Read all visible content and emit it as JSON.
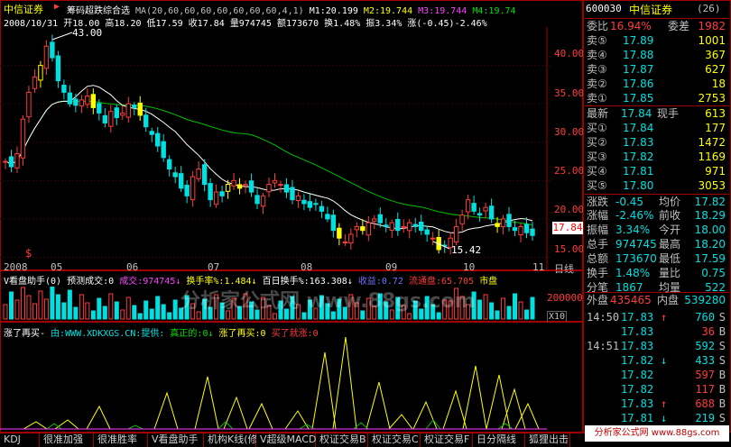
{
  "header": {
    "app_name": "中信证券",
    "indicator_title": "筹码超跌综合选",
    "ma_label": "MA(20,60,60,60,60,60,60,60,4,1)",
    "m1": "M1:20.199",
    "m2": "M2:19.744",
    "m3": "M3:19.744",
    "m4": "M4:19.74"
  },
  "ohlc": {
    "date": "2008/10/31",
    "open": "开18.00",
    "high": "高18.20",
    "low": "低17.59",
    "close": "收17.84",
    "volume": "量974745",
    "amount": "额173670",
    "turnover": "换1.48%",
    "amplitude": "振3.34%",
    "change": "涨(-0.45)-2.46%"
  },
  "main_chart": {
    "price_axis": [
      "40.00",
      "35.00",
      "30.00",
      "25.00",
      "20.00",
      "15.00"
    ],
    "high_marker": "43.00",
    "low_marker": "15.42",
    "current_price_tag": "17.84",
    "x_labels": [
      "2008",
      "05",
      "06",
      "07",
      "08",
      "09",
      "10",
      "11"
    ],
    "period_label": "日线"
  },
  "volume_panel": {
    "title": "V看盘助手(0)",
    "predict": "预测成交:0",
    "vol": "成交:974745↓",
    "turnover": "换手率%:1.484↓",
    "hundred": "百日换手%:163.308↓",
    "profit": "收益:0.72",
    "float_cap": "流通盘:65.705",
    "market": "市盘",
    "axis_label": "200000",
    "unit": "X10"
  },
  "lower_panel": {
    "title": "涨了再买-",
    "source": "由:WWW.XDKXGS.CN:提供:",
    "real": "真正的:0↓",
    "rise": "涨了再买:0",
    "buy": "买了就涨:0"
  },
  "watermark": "分析家公式网 www.88gs.com",
  "quote": {
    "code": "600030",
    "name": "中信证券",
    "count": "(26)",
    "weibi_label": "委比",
    "weibi_value": "16.94%",
    "weicha_label": "委差",
    "weicha_value": "1982",
    "sells": [
      {
        "label": "卖⑤",
        "price": "17.89",
        "vol": "1001"
      },
      {
        "label": "卖④",
        "price": "17.88",
        "vol": "367"
      },
      {
        "label": "卖③",
        "price": "17.87",
        "vol": "627"
      },
      {
        "label": "卖②",
        "price": "17.86",
        "vol": "18"
      },
      {
        "label": "卖①",
        "price": "17.85",
        "vol": "2753"
      }
    ],
    "latest_label": "最新",
    "latest_value": "17.84",
    "now_vol_label": "现手",
    "now_vol_value": "613",
    "buys": [
      {
        "label": "买①",
        "price": "17.84",
        "vol": "177"
      },
      {
        "label": "买②",
        "price": "17.83",
        "vol": "1472"
      },
      {
        "label": "买③",
        "price": "17.82",
        "vol": "1169"
      },
      {
        "label": "买④",
        "price": "17.81",
        "vol": "971"
      },
      {
        "label": "买⑤",
        "price": "17.80",
        "vol": "3053"
      }
    ],
    "stats": [
      {
        "l1": "涨跌",
        "v1": "-0.45",
        "l2": "均价",
        "v2": "17.82"
      },
      {
        "l1": "涨幅",
        "v1": "-2.46%",
        "l2": "前收",
        "v2": "18.29"
      },
      {
        "l1": "振幅",
        "v1": "3.34%",
        "l2": "今开",
        "v2": "18.00"
      },
      {
        "l1": "总手",
        "v1": "974745",
        "l2": "最高",
        "v2": "18.20"
      },
      {
        "l1": "总额",
        "v1": "173670",
        "l2": "最低",
        "v2": "17.59"
      },
      {
        "l1": "换手",
        "v1": "1.48%",
        "l2": "量比",
        "v2": "0.75"
      },
      {
        "l1": "分笔",
        "v1": "1867",
        "l2": "均量",
        "v2": "522"
      }
    ],
    "outer_label": "外盘",
    "outer_value": "435465",
    "inner_label": "内盘",
    "inner_value": "539280"
  },
  "ticks": [
    {
      "time": "14:50",
      "price": "17.83",
      "arrow": "↑",
      "vol": "760",
      "side": "S"
    },
    {
      "time": "",
      "price": "17.83",
      "arrow": "",
      "vol": "36",
      "side": "B"
    },
    {
      "time": "14:51",
      "price": "17.83",
      "arrow": "",
      "vol": "592",
      "side": "S"
    },
    {
      "time": "",
      "price": "17.82",
      "arrow": "↓",
      "vol": "433",
      "side": "S"
    },
    {
      "time": "",
      "price": "17.82",
      "arrow": "",
      "vol": "597",
      "side": "B"
    },
    {
      "time": "",
      "price": "17.82",
      "arrow": "",
      "vol": "117",
      "side": "B"
    },
    {
      "time": "",
      "price": "17.83",
      "arrow": "↑",
      "vol": "688",
      "side": "B"
    },
    {
      "time": "",
      "price": "17.81",
      "arrow": "↓",
      "vol": "219",
      "side": "S"
    }
  ],
  "tabs": [
    "KDJ",
    "很准加强",
    "很准胜率",
    "V看盘助手",
    "机构K线(修",
    "V超级MACD",
    "权证交易B",
    "权证交易C",
    "权证交易F",
    "日分隔线",
    "狐狸出击"
  ],
  "footer_watermark": "分析家公式网 www.88gs.com",
  "colors": {
    "up": "#ff3c3c",
    "down": "#00e0e0",
    "flat": "#ffffff",
    "frame": "#a00000",
    "ma20": "#ffffff",
    "ma60": "#00c000"
  },
  "chart_data": {
    "type": "candlestick",
    "x_range": [
      "2008-04",
      "2008-10-31"
    ],
    "y_range": [
      14,
      45
    ],
    "closes": [
      27.5,
      26.8,
      28.5,
      33.0,
      36.5,
      38.5,
      40.0,
      42.5,
      41.0,
      38.0,
      36.5,
      35.0,
      34.8,
      35.5,
      36.0,
      34.5,
      33.8,
      32.5,
      34.0,
      33.2,
      33.8,
      35.0,
      34.5,
      33.5,
      32.0,
      31.0,
      29.5,
      28.0,
      26.5,
      25.5,
      24.0,
      23.0,
      25.5,
      26.5,
      24.5,
      22.5,
      23.5,
      23.0,
      24.5,
      25.0,
      24.0,
      24.5,
      23.5,
      22.0,
      23.0,
      24.5,
      25.0,
      24.5,
      23.5,
      22.5,
      23.0,
      22.0,
      21.5,
      22.0,
      21.0,
      20.0,
      18.5,
      17.5,
      17.0,
      18.0,
      19.0,
      18.5,
      19.5,
      20.0,
      19.5,
      19.0,
      19.5,
      18.5,
      19.0,
      19.5,
      19.0,
      18.5,
      18.0,
      17.5,
      16.0,
      16.5,
      17.5,
      19.0,
      20.5,
      22.5,
      21.0,
      20.5,
      21.5,
      20.0,
      19.0,
      20.0,
      19.0,
      18.5,
      19.0,
      18.2,
      17.84
    ]
  }
}
